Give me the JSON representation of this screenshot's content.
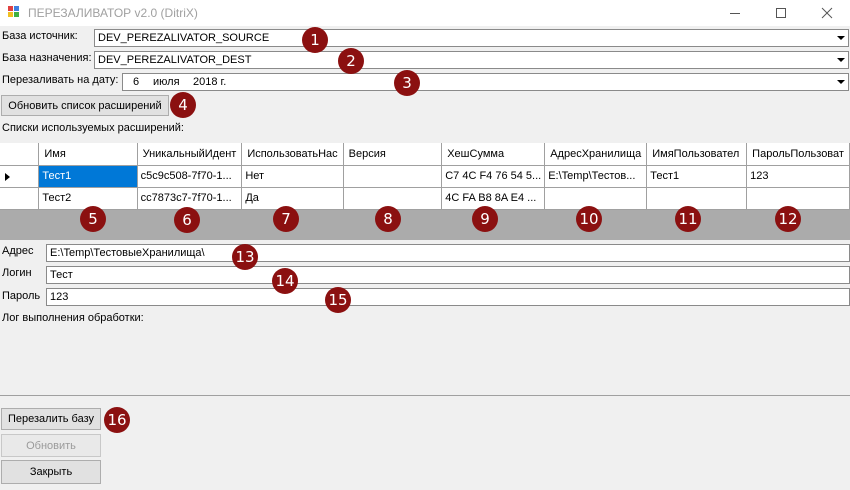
{
  "window": {
    "title": "ПЕРЕЗАЛИВАТОР v2.0 (DitriX)"
  },
  "form": {
    "source_label": "База источник:",
    "source_value": "DEV_PEREZALIVATOR_SOURCE",
    "dest_label": "База назначения:",
    "dest_value": "DEV_PEREZALIVATOR_DEST",
    "date_label": "Перезаливать на дату:",
    "date_day": "6",
    "date_month": "июля",
    "date_year": "2018 г.",
    "refresh_ext_button": "Обновить список расширений",
    "ext_list_label": "Списки используемых расширений:"
  },
  "grid": {
    "columns": [
      "Имя",
      "УникальныйИдент",
      "ИспользоватьНас",
      "Версия",
      "ХешСумма",
      "АдресХранилища",
      "ИмяПользовател",
      "ПарольПользоват"
    ],
    "rows": [
      [
        "Тест1",
        "c5c9c508-7f70-1...",
        "Нет",
        "",
        "C7 4C F4 76 54 5...",
        "E:\\Temp\\Тестов...",
        "Тест1",
        "123"
      ],
      [
        "Тест2",
        "cc7873c7-7f70-1...",
        "Да",
        "",
        "4C FA B8 8A E4 ...",
        "",
        "",
        ""
      ]
    ]
  },
  "details": {
    "address_label": "Адрес",
    "address_value": "E:\\Temp\\ТестовыеХранилища\\",
    "login_label": "Логин",
    "login_value": "Тест",
    "password_label": "Пароль",
    "password_value": "123",
    "log_label": "Лог выполнения обработки:"
  },
  "actions": {
    "reupload_button": "Перезалить базу",
    "update_button": "Обновить",
    "close_button": "Закрыть"
  },
  "annotations": [
    "1",
    "2",
    "3",
    "4",
    "5",
    "6",
    "7",
    "8",
    "9",
    "10",
    "11",
    "12",
    "13",
    "14",
    "15",
    "16"
  ],
  "colors": {
    "marker": "#8b1010",
    "selection": "#0078d7"
  }
}
